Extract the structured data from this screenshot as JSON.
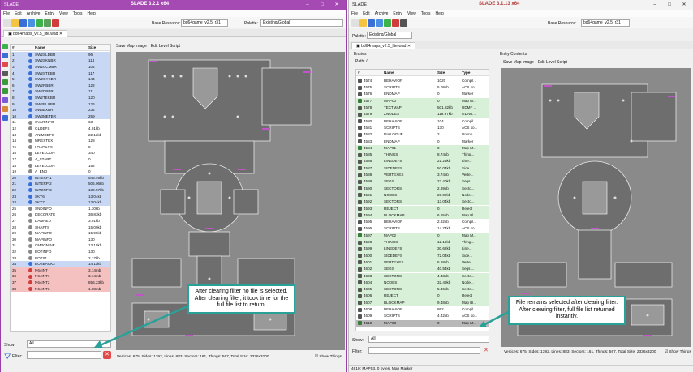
{
  "left": {
    "app": "SLADE",
    "title": "SLADE 3.2.1 x64",
    "menu": [
      "File",
      "Edit",
      "Archive",
      "Entry",
      "View",
      "Tools",
      "Help"
    ],
    "base_resource_label": "Base Resource:",
    "base_resource": "bd64game_v2.5_r31",
    "palette_label": "Palette:",
    "palette": "Existing/Global",
    "tab": "bd64maps_v2.5_lite.wad",
    "cols": [
      "#",
      "Name",
      "Size"
    ],
    "rows": [
      [
        "1",
        "SW2SLDBR",
        "96",
        1
      ],
      [
        "2",
        "SW2SKNBR",
        "114",
        1
      ],
      [
        "3",
        "SW2CCMBR",
        "102",
        1
      ],
      [
        "4",
        "SW2STEBR",
        "117",
        1
      ],
      [
        "5",
        "SW2GYEBR",
        "144",
        1
      ],
      [
        "6",
        "SW2RBBR",
        "122",
        1
      ],
      [
        "7",
        "SW2DBBR",
        "111",
        1
      ],
      [
        "8",
        "SW2TEKBR",
        "120",
        1
      ],
      [
        "9",
        "SW2BLUBR",
        "126",
        1
      ],
      [
        "10",
        "SW3EXBR",
        "232",
        1
      ],
      [
        "10",
        "SW3METBR",
        "259",
        1
      ],
      [
        "11",
        "CVARINFO",
        "63",
        0
      ],
      [
        "12",
        "GLDEFS",
        "4.01kb",
        0
      ],
      [
        "13",
        "ANIMDEFS",
        "22.12kb",
        0
      ],
      [
        "14",
        "MRESTEX",
        "128",
        0
      ],
      [
        "15",
        "LOADACS",
        "8",
        0
      ],
      [
        "16",
        "LEVELCON",
        "340",
        0
      ],
      [
        "17",
        "A_START",
        "0",
        0
      ],
      [
        "18",
        "LEVELCON",
        "152",
        0
      ],
      [
        "19",
        "A_END",
        "0",
        0
      ],
      [
        "20",
        "INTERPI1",
        "545.46kb",
        1
      ],
      [
        "21",
        "INTERPI2",
        "505.06kb",
        1
      ],
      [
        "22",
        "INTERPI3",
        "180.57kb",
        1
      ],
      [
        "23",
        "SKY6",
        "13.04kb",
        1
      ],
      [
        "24",
        "SKY7",
        "13.04kb",
        1
      ],
      [
        "25",
        "SNDINFO",
        "1.30kb",
        0
      ],
      [
        "26",
        "DECORATE",
        "36.83kb",
        0
      ],
      [
        "27",
        "DAMNED",
        "3.91kb",
        0
      ],
      [
        "28",
        "SHAFTS",
        "15.09kb",
        0
      ],
      [
        "29",
        "MAPINFO",
        "15.95kb",
        0
      ],
      [
        "30",
        "MAPINFO",
        "130",
        0
      ],
      [
        "31",
        "CMPGNINF",
        "13.15kb",
        0
      ],
      [
        "32",
        "BOTINFO",
        "130",
        0
      ],
      [
        "33",
        "BOTS1",
        "2.17kb",
        0
      ],
      [
        "34",
        "BOSBACK2",
        "14.11kb",
        1
      ],
      [
        "35",
        "N64INT",
        "3.14mb",
        2
      ],
      [
        "36",
        "N64INT1",
        "3.14mb",
        2
      ],
      [
        "37",
        "N64INT2",
        "856.23kb",
        2
      ],
      [
        "38",
        "N64INT3",
        "1.08mb",
        2
      ]
    ],
    "show_label": "Show:",
    "show_value": "All",
    "filter_label": "Filter:",
    "map_buttons": [
      "Save Map Image",
      "Edit Level Script"
    ],
    "map_status": "Vertices: 675, Sides: 1392, Lines: 883, Sectors: 161, Things: 567, Total Size: 2336x3200",
    "show_things": "Show Things",
    "callout": "After clearing filter no file is selected. After clearing filter, it took time for the full file list to return."
  },
  "right": {
    "app": "SLADE",
    "title": "SLADE 3.1.13 x64",
    "menu": [
      "File",
      "Edit",
      "Archive",
      "Entry",
      "View",
      "Tools",
      "Help"
    ],
    "base_resource_label": "Base Resource:",
    "base_resource": "bd64game_v2.5_r31",
    "palette_label": "Palette:",
    "palette": "Existing/Global",
    "tab": "bd64maps_v2.5_lite.wad",
    "entries_label": "Entries",
    "path": "Path: /",
    "contents_label": "Entry Contents",
    "cols": [
      "#",
      "Name",
      "Size",
      "Type"
    ],
    "rows": [
      [
        "4574",
        "BEHAVIOR",
        "1020",
        "Compil..."
      ],
      [
        "4575",
        "SCRIPTS",
        "5.08kb",
        "ACS so..."
      ],
      [
        "4576",
        "ENDMAP",
        "0",
        "Marker"
      ],
      [
        "4577",
        "MAP00",
        "0",
        "Map M..."
      ],
      [
        "4578",
        "TEXTMAP",
        "501.82kb",
        "UDMF ..."
      ],
      [
        "4579",
        "ZNODES",
        "119.97kb",
        "GL No..."
      ],
      [
        "4580",
        "BEHAVIOR",
        "104",
        "Compil..."
      ],
      [
        "4581",
        "SCRIPTS",
        "130",
        "ACS so..."
      ],
      [
        "4582",
        "DIALOGUE",
        "2",
        "Unkno..."
      ],
      [
        "4583",
        "ENDMAP",
        "0",
        "Marker"
      ],
      [
        "4584",
        "MAP01",
        "0",
        "Map M..."
      ],
      [
        "4585",
        "THINGS",
        "8.74kb",
        "Thing..."
      ],
      [
        "4586",
        "LINEDEFS",
        "21.23kb",
        "Line..."
      ],
      [
        "4587",
        "SIDEDEFS",
        "50.04kb",
        "Side..."
      ],
      [
        "4588",
        "VERTEXES",
        "3.74kb",
        "Verte..."
      ],
      [
        "4589",
        "SEGS",
        "23.40kb",
        "Segs ..."
      ],
      [
        "4590",
        "SECTORS",
        "2.89kb",
        "Secto..."
      ],
      [
        "4591",
        "NODES",
        "20.02kb",
        "Node..."
      ],
      [
        "4592",
        "SECTORS",
        "13.04kb",
        "Secto..."
      ],
      [
        "4593",
        "REJECT",
        "0",
        "Reject"
      ],
      [
        "4594",
        "BLOCKMAP",
        "6.65kb",
        "Map Bl..."
      ],
      [
        "4595",
        "BEHAVIOR",
        "2.82kb",
        "Compil..."
      ],
      [
        "4596",
        "SCRIPTS",
        "14.74kb",
        "ACS so..."
      ],
      [
        "4597",
        "MAP02",
        "0",
        "Map M..."
      ],
      [
        "4598",
        "THINGS",
        "12.19kb",
        "Thing..."
      ],
      [
        "4599",
        "LINEDEFS",
        "30.62kb",
        "Line..."
      ],
      [
        "4600",
        "SIDEDEFS",
        "72.04kb",
        "Side..."
      ],
      [
        "4601",
        "VERTEXES",
        "5.68kb",
        "Verte..."
      ],
      [
        "4602",
        "SEGS",
        "40.54kb",
        "Segs ..."
      ],
      [
        "4603",
        "SECTORS",
        "4.43kb",
        "Secto..."
      ],
      [
        "4604",
        "NODES",
        "32.49kb",
        "Node..."
      ],
      [
        "4605",
        "SECTORS",
        "5.46kb",
        "Secto..."
      ],
      [
        "4606",
        "REJECT",
        "0",
        "Reject"
      ],
      [
        "4607",
        "BLOCKMAP",
        "9.48kb",
        "Map Bl..."
      ],
      [
        "4608",
        "BEHAVIOR",
        "992",
        "Compil..."
      ],
      [
        "4609",
        "SCRIPTS",
        "4.42kb",
        "ACS so..."
      ],
      [
        "4610",
        "MAP03",
        "0",
        "Map M..."
      ]
    ],
    "show_label": "Show:",
    "show_value": "All",
    "filter_label": "Filter:",
    "map_buttons": [
      "Save Map Image",
      "Edit Level Script"
    ],
    "map_status": "Vertices: 675, Sides: 1392, Lines: 883, Sectors: 161, Things: 567, Total Size: 2336x3200",
    "show_things": "Show Things",
    "statusbar": "4610: MAP03, 0 bytes, Map Marker",
    "callout": "File remains selected after clearing filter. After clearing filter, full file list returned instantly."
  },
  "colors": {
    "left_title": "#a54ab3",
    "accent": "#2aa198",
    "blue_row": "#c8d8f4",
    "red_row": "#f4c0c0",
    "green_row": "#d8f0d8"
  },
  "icons": [
    "window-minimize-icon",
    "window-maximize-icon",
    "close-icon",
    "wad-file-icon",
    "filter-icon",
    "clear-icon"
  ]
}
